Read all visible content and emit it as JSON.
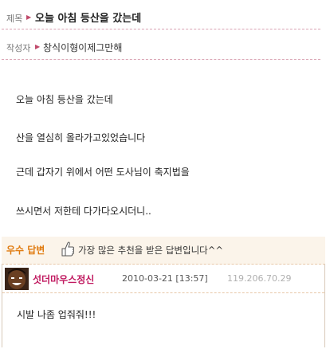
{
  "post": {
    "title_label": "제목",
    "title": "오늘 아침 등산을 갔는데",
    "writer_label": "작성자",
    "writer": "창식이형이제그만해",
    "body_lines": [
      "오늘 아침 등산을 갔는데",
      "산을 열심히 올라가고있었습니다",
      "근데 갑자기 위에서 어떤 도사님이 축지법을",
      "쓰시면서 저한테 다가다오시더니.."
    ]
  },
  "best_answer": {
    "label": "우수 답변",
    "description": "가장 많은 추천을 받은 답변입니다^^",
    "author": "섯더마우스정신",
    "date": "2010-03-21 [13:57]",
    "ip": "119.206.70.29",
    "text": "시발 나좀 업줘줘!!!"
  },
  "colors": {
    "accent_pink": "#c0185f",
    "accent_orange": "#e07b10",
    "best_bg": "#fbf4ea"
  }
}
